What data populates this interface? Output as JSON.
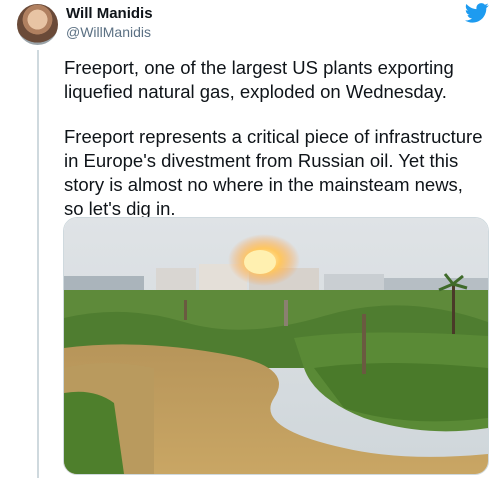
{
  "tweet": {
    "author": {
      "display_name": "Will Manidis",
      "handle": "@WillManidis"
    },
    "paragraphs": [
      "Freeport, one of the largest US plants exporting liquefied natural gas, exploded on Wednesday.",
      "Freeport represents a critical piece of infrastructure in Europe's divestment from Russian oil. Yet this story is almost no where in the mainsteam news, so let's dig in."
    ],
    "brand_color": "#1d9bf0"
  },
  "icons": {
    "logo": "twitter-bird-icon"
  }
}
